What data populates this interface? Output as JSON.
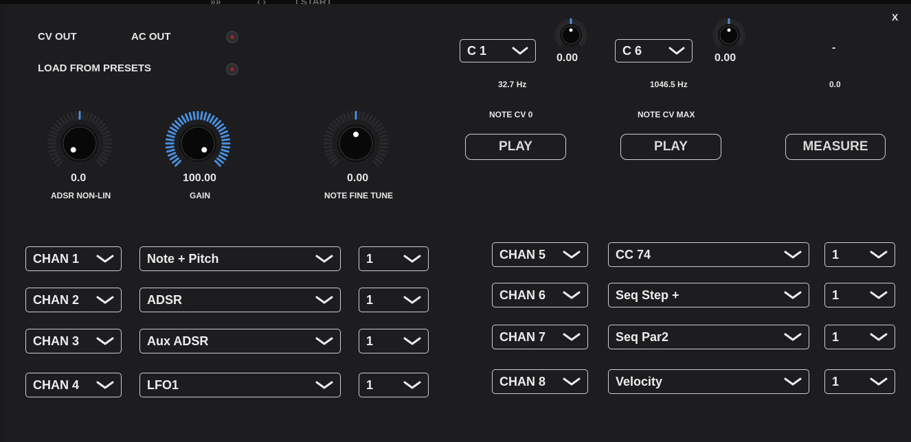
{
  "top_strip_fragments": [
    "»»",
    "‹ ›",
    "| START"
  ],
  "close_label": "X",
  "routing": {
    "cv_out_label": "CV OUT",
    "ac_out_label": "AC OUT",
    "load_presets_label": "LOAD FROM PRESETS"
  },
  "knobs": {
    "adsr_nonlin": {
      "value": "0.0",
      "label": "ADSR NON-LIN",
      "level": 0.0
    },
    "gain": {
      "value": "100.00",
      "label": "GAIN",
      "level": 1.0
    },
    "note_fine_tune": {
      "value": "0.00",
      "label": "NOTE FINE TUNE",
      "level": 0.5
    }
  },
  "calibration": {
    "note_cv0": {
      "note": "C 1",
      "fine": "0.00",
      "freq": "32.7 Hz",
      "label": "NOTE CV 0",
      "play": "PLAY"
    },
    "note_cvmax": {
      "note": "C 6",
      "fine": "0.00",
      "freq": "1046.5 Hz",
      "label": "NOTE CV MAX",
      "play": "PLAY"
    },
    "measure": {
      "dash": "-",
      "value": "0.0",
      "button": "MEASURE"
    }
  },
  "channels_left": [
    {
      "chan": "CHAN 1",
      "source": "Note + Pitch",
      "num": "1"
    },
    {
      "chan": "CHAN 2",
      "source": "ADSR",
      "num": "1"
    },
    {
      "chan": "CHAN 3",
      "source": "Aux ADSR",
      "num": "1"
    },
    {
      "chan": "CHAN 4",
      "source": "LFO1",
      "num": "1"
    }
  ],
  "channels_right": [
    {
      "chan": "CHAN 5",
      "source": "CC 74",
      "num": "1"
    },
    {
      "chan": "CHAN 6",
      "source": "Seq Step +",
      "num": "1"
    },
    {
      "chan": "CHAN 7",
      "source": "Seq Par2",
      "num": "1"
    },
    {
      "chan": "CHAN 8",
      "source": "Velocity",
      "num": "1"
    }
  ],
  "colors": {
    "accent": "#4a8fe0",
    "background": "#1d1d1f",
    "border": "#cfcfcf",
    "led": "#8a2830"
  }
}
